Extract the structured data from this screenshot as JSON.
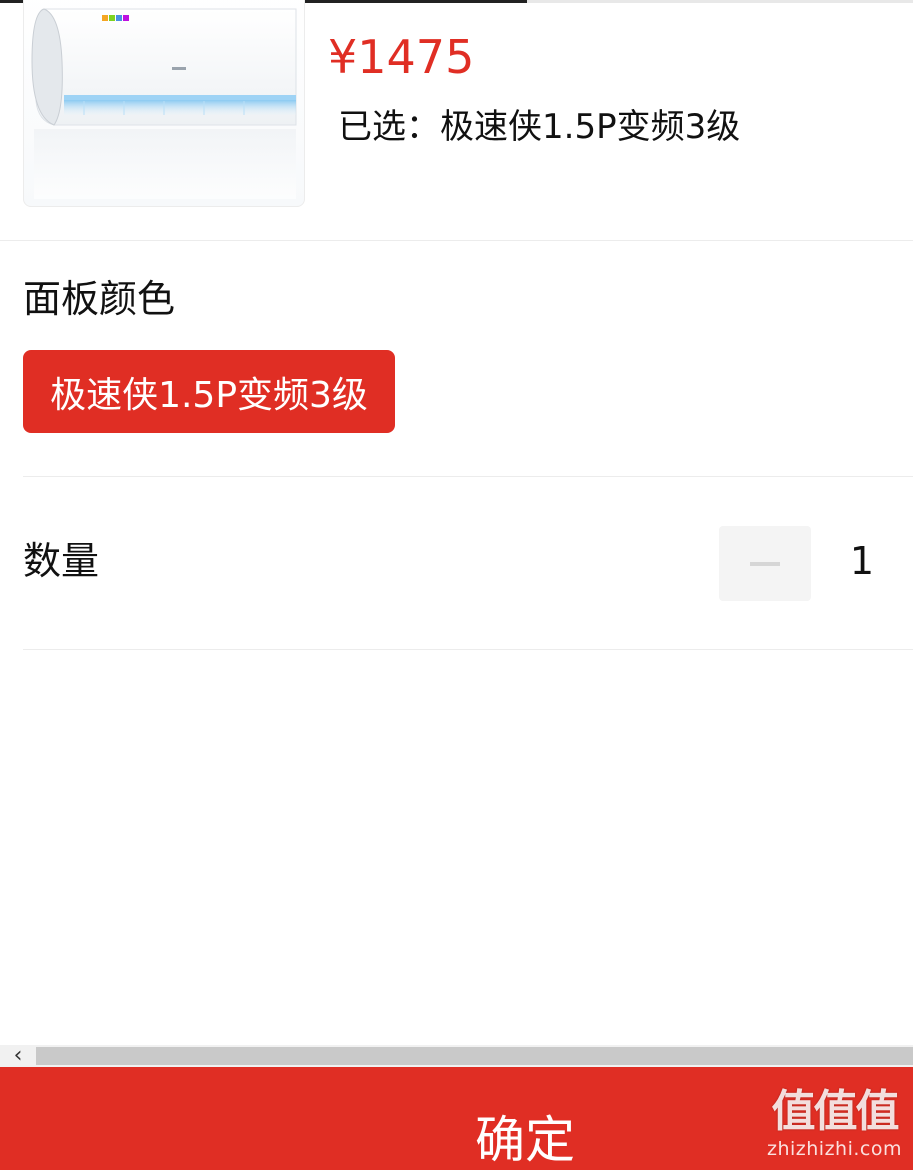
{
  "product": {
    "image_alt": "air-conditioner-product-image",
    "price": "¥1475",
    "selected_text": "已选：极速侠1.5P变频3级"
  },
  "spec": {
    "title": "面板颜色",
    "options": [
      {
        "label": "极速侠1.5P变频3级",
        "selected": true
      }
    ]
  },
  "quantity": {
    "title": "数量",
    "value": "1",
    "minus_icon": "minus-icon"
  },
  "scrollbar": {
    "left_arrow": "‹"
  },
  "footer": {
    "confirm_label": "确定"
  },
  "watermark": {
    "logo_text": "值值值",
    "domain": "zhizhizhi.com"
  },
  "colors": {
    "accent": "#e02e24",
    "stepper_bg": "#f4f4f4",
    "divider": "#ececec"
  }
}
